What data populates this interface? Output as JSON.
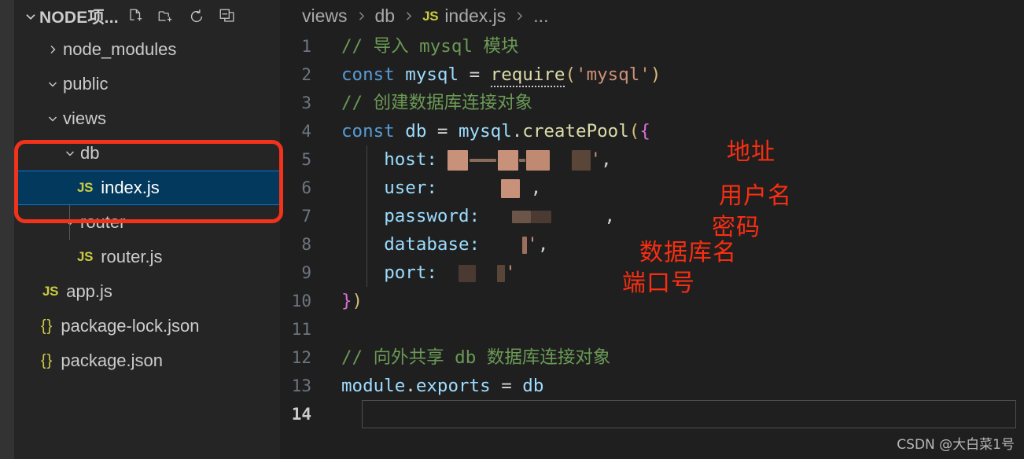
{
  "explorer": {
    "title": "NODE项...",
    "twisty_icon": "chevron-down-icon",
    "actions": [
      {
        "name": "new-file-icon",
        "label": "New File"
      },
      {
        "name": "new-folder-icon",
        "label": "New Folder"
      },
      {
        "name": "refresh-icon",
        "label": "Refresh Explorer"
      },
      {
        "name": "collapse-all-icon",
        "label": "Collapse Folders in Explorer"
      }
    ],
    "tree": [
      {
        "label": "node_modules",
        "type": "folder",
        "state": "collapsed",
        "indent": 1,
        "icon": "chevron-right-icon"
      },
      {
        "label": "public",
        "type": "folder",
        "state": "expanded",
        "indent": 1,
        "icon": "chevron-down-icon"
      },
      {
        "label": "views",
        "type": "folder",
        "state": "expanded",
        "indent": 1,
        "icon": "chevron-down-icon"
      },
      {
        "label": "db",
        "type": "folder",
        "state": "expanded",
        "indent": 2,
        "icon": "chevron-down-icon"
      },
      {
        "label": "index.js",
        "type": "file",
        "indent": 3,
        "icon": "js-file-icon",
        "badge": "JS",
        "selected": true
      },
      {
        "label": "router",
        "type": "folder",
        "state": "expanded",
        "indent": 2,
        "icon": "chevron-down-icon"
      },
      {
        "label": "router.js",
        "type": "file",
        "indent": 3,
        "icon": "js-file-icon",
        "badge": "JS"
      },
      {
        "label": "app.js",
        "type": "file",
        "indent": 1,
        "icon": "js-file-icon",
        "badge": "JS"
      },
      {
        "label": "package-lock.json",
        "type": "file",
        "indent": 1,
        "icon": "json-file-icon",
        "badge": "{}"
      },
      {
        "label": "package.json",
        "type": "file",
        "indent": 1,
        "icon": "json-file-icon",
        "badge": "{}"
      }
    ]
  },
  "breadcrumb": {
    "items": [
      "views",
      "db",
      "index.js",
      "..."
    ],
    "file_badge": "JS",
    "separator": "chevron-right-icon"
  },
  "editor": {
    "line_numbers": [
      "1",
      "2",
      "3",
      "4",
      "5",
      "6",
      "7",
      "8",
      "9",
      "10",
      "11",
      "12",
      "13",
      "14"
    ],
    "current_line": 14,
    "lines": [
      {
        "n": 1,
        "text": "// 导入 mysql 模块"
      },
      {
        "n": 2,
        "text": "const mysql = require('mysql')"
      },
      {
        "n": 3,
        "text": "// 创建数据库连接对象"
      },
      {
        "n": 4,
        "text": "const db = mysql.createPool({"
      },
      {
        "n": 5,
        "text": "    host: ███ ██ ██   ██',"
      },
      {
        "n": 6,
        "text": "    user:       ██ ,"
      },
      {
        "n": 7,
        "text": "    password:    ████      ,"
      },
      {
        "n": 8,
        "text": "    database:      ▎',"
      },
      {
        "n": 9,
        "text": "    port:  ██  ▌'"
      },
      {
        "n": 10,
        "text": "})"
      },
      {
        "n": 11,
        "text": ""
      },
      {
        "n": 12,
        "text": "// 向外共享 db 数据库连接对象"
      },
      {
        "n": 13,
        "text": "module.exports = db"
      },
      {
        "n": 14,
        "text": ""
      }
    ],
    "tokens": {
      "comment1": "// 导入 mysql 模块",
      "comment3": "// 创建数据库连接对象",
      "comment12": "// 向外共享 db 数据库连接对象",
      "kw_const": "const",
      "var_mysql": "mysql",
      "var_db": "db",
      "op_eq": "=",
      "fn_require": "require",
      "str_mysql": "'mysql'",
      "obj_mysql": "mysql",
      "dot": ".",
      "fn_createPool": "createPool",
      "open_paren": "(",
      "open_brace": "{",
      "close_brace": "}",
      "close_paren": ")",
      "prop_host": "host:",
      "prop_user": "user:",
      "prop_password": "password:",
      "prop_database": "database:",
      "prop_port": "port:",
      "comma": ",",
      "quote": "'",
      "mod_module": "module",
      "mod_exports": "exports",
      "mod_db": "db"
    }
  },
  "annotations": [
    {
      "text": "地址",
      "meaning": "address"
    },
    {
      "text": "用户名",
      "meaning": "username"
    },
    {
      "text": "密码",
      "meaning": "password"
    },
    {
      "text": "数据库名",
      "meaning": "database name"
    },
    {
      "text": "端口号",
      "meaning": "port number"
    }
  ],
  "watermark": "CSDN @大白菜1号",
  "colors": {
    "accent_red": "#f0331a",
    "selection_blue": "#04395e",
    "selection_border": "#0078d4",
    "editor_bg": "#1f1f1f",
    "sidebar_bg": "#252526",
    "activitybar_bg": "#333333",
    "comment": "#6a9955",
    "keyword": "#569cd6",
    "variable": "#9cdcfe",
    "function": "#dcdcaa",
    "string": "#ce9178",
    "redact_light": "#c8917a",
    "redact_dark": "#5a4539"
  }
}
